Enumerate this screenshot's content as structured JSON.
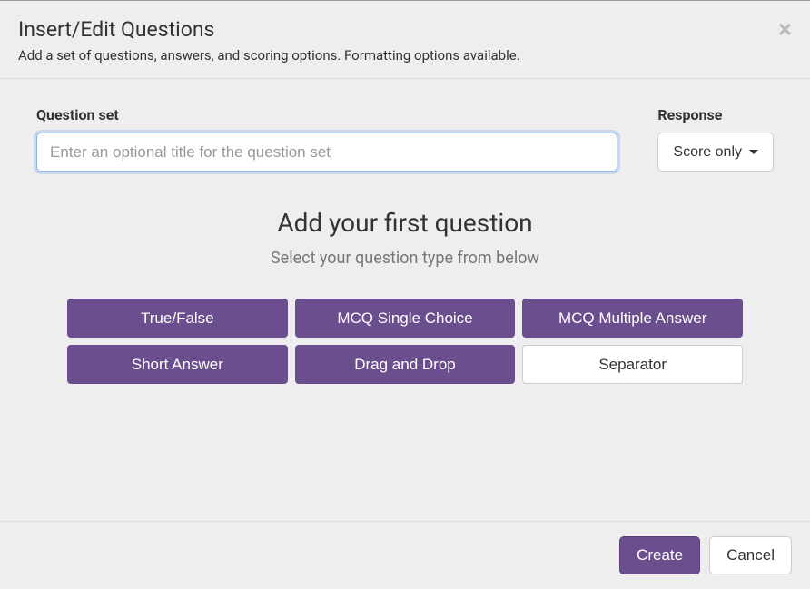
{
  "header": {
    "title": "Insert/Edit Questions",
    "subtitle": "Add a set of questions, answers, and scoring options. Formatting options available."
  },
  "form": {
    "question_set_label": "Question set",
    "question_set_placeholder": "Enter an optional title for the question set",
    "question_set_value": "",
    "response_label": "Response",
    "response_selected": "Score only"
  },
  "prompt": {
    "heading": "Add your first question",
    "subheading": "Select your question type from below"
  },
  "types": {
    "true_false": "True/False",
    "mcq_single": "MCQ Single Choice",
    "mcq_multiple": "MCQ Multiple Answer",
    "short_answer": "Short Answer",
    "drag_drop": "Drag and Drop",
    "separator": "Separator"
  },
  "footer": {
    "create": "Create",
    "cancel": "Cancel"
  }
}
